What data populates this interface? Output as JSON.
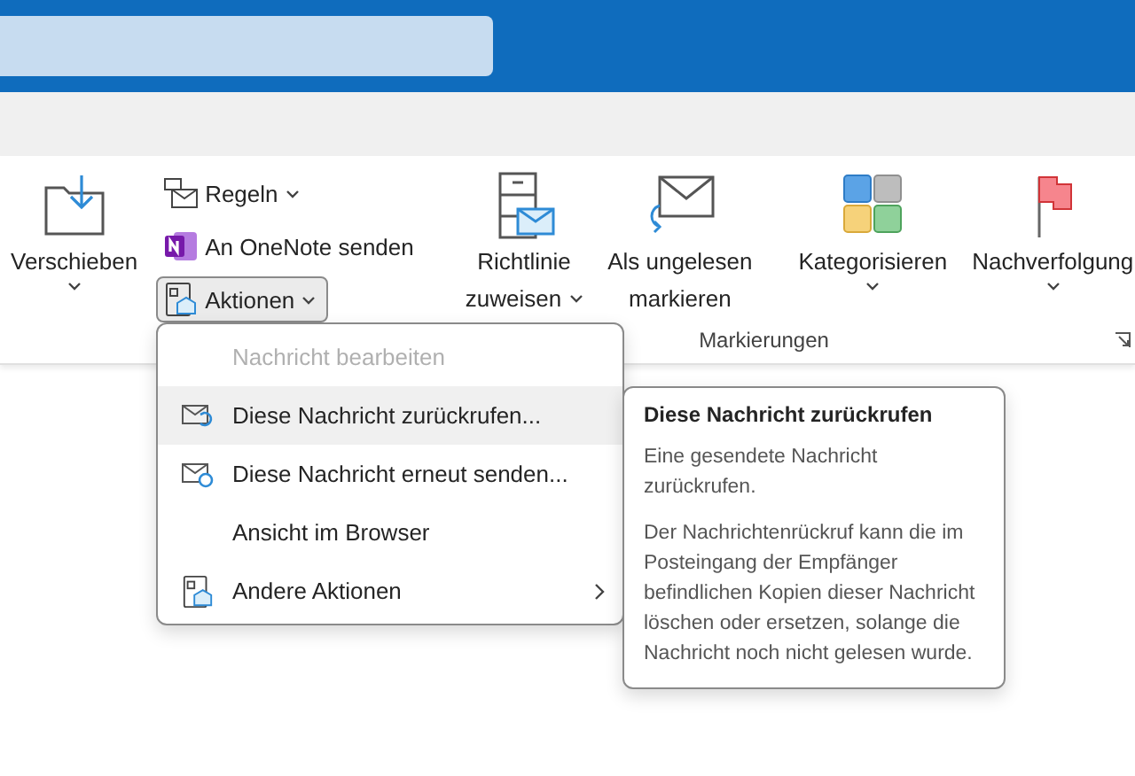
{
  "ribbon": {
    "large_left": {
      "label": "Verschieben",
      "dropdown": true
    },
    "small_buttons": [
      {
        "kind": "rules",
        "label": "Regeln",
        "dropdown": true,
        "pressed": false
      },
      {
        "kind": "onenote",
        "label": "An OneNote senden",
        "dropdown": false,
        "pressed": false
      },
      {
        "kind": "actions",
        "label": "Aktionen",
        "dropdown": true,
        "pressed": true
      }
    ],
    "group": {
      "label": "Markierungen",
      "buttons": [
        {
          "kind": "policy",
          "lines": [
            "Richtlinie",
            "zuweisen"
          ],
          "dropdown": true
        },
        {
          "kind": "unread",
          "lines": [
            "Als ungelesen",
            "markieren"
          ],
          "dropdown": false
        },
        {
          "kind": "categorize",
          "lines": [
            "Kategorisieren"
          ],
          "dropdown": true
        },
        {
          "kind": "flag",
          "lines": [
            "Nachverfolgung"
          ],
          "dropdown": true
        }
      ]
    }
  },
  "menu": {
    "items": [
      {
        "kind": "plain",
        "label": "Nachricht bearbeiten",
        "disabled": true,
        "selected": false,
        "submenu": false
      },
      {
        "kind": "recall",
        "label": "Diese Nachricht zurückrufen...",
        "disabled": false,
        "selected": true,
        "submenu": false
      },
      {
        "kind": "resend",
        "label": "Diese Nachricht erneut senden...",
        "disabled": false,
        "selected": false,
        "submenu": false
      },
      {
        "kind": "plain",
        "label": "Ansicht im Browser",
        "disabled": false,
        "selected": false,
        "submenu": false
      },
      {
        "kind": "more",
        "label": "Andere Aktionen",
        "disabled": false,
        "selected": false,
        "submenu": true
      }
    ]
  },
  "tooltip": {
    "title": "Diese Nachricht zurückrufen",
    "paragraphs": [
      "Eine gesendete Nachricht zurückrufen.",
      "Der Nachrichtenrückruf kann die im Posteingang der Empfänger befindlichen Kopien dieser Nachricht löschen oder ersetzen, solange die Nachricht noch nicht gelesen wurde."
    ]
  }
}
